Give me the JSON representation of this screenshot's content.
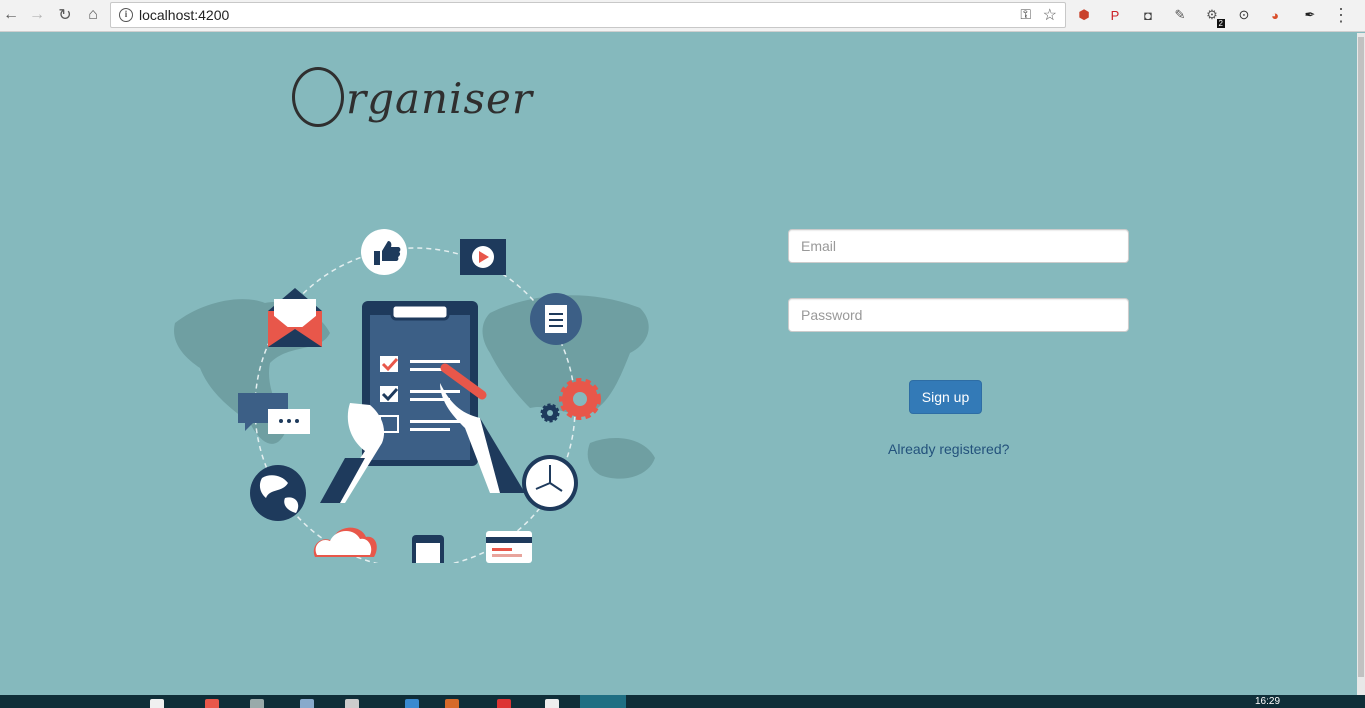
{
  "browser": {
    "url": "localhost:4200",
    "extensions": [
      {
        "name": "ublock-icon",
        "color": "#c9412b",
        "glyph": "⬢"
      },
      {
        "name": "pinterest-icon",
        "color": "#cb2027",
        "glyph": "P"
      },
      {
        "name": "shield-extension-icon",
        "color": "#444444",
        "glyph": "◘"
      },
      {
        "name": "broom-extension-icon",
        "color": "#555555",
        "glyph": "✎"
      },
      {
        "name": "puzzle-extension-icon",
        "color": "#555555",
        "glyph": "⚙",
        "badge": "2"
      },
      {
        "name": "circle-target-icon",
        "color": "#333333",
        "glyph": "⊙"
      },
      {
        "name": "colorful-extension-icon",
        "color": "#d94f2b",
        "glyph": "◕"
      },
      {
        "name": "eyedropper-extension-icon",
        "color": "#222222",
        "glyph": "✒"
      }
    ]
  },
  "brand": {
    "logo_rest": "rganiser"
  },
  "form": {
    "email_placeholder": "Email",
    "password_placeholder": "Password",
    "signup_label": "Sign up",
    "already_registered_label": "Already registered?"
  },
  "taskbar": {
    "clock": "16:29"
  },
  "colors": {
    "page_bg": "#85b9bd",
    "primary_button": "#337ab7",
    "link": "#23527c",
    "illustration_navy": "#1e3a5c",
    "illustration_red": "#e8574a"
  }
}
